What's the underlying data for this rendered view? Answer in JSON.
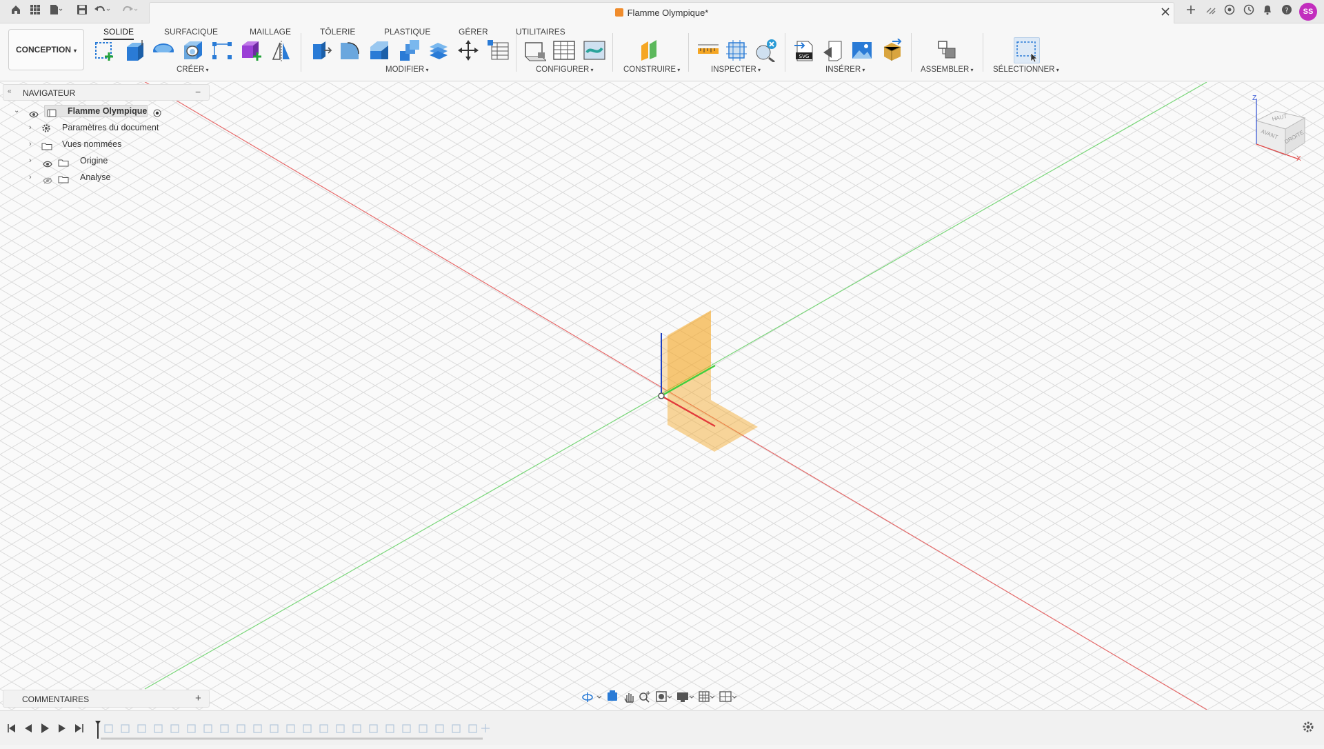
{
  "titlebar": {
    "document_title": "Flamme Olympique*",
    "avatar_initials": "SS",
    "left_icons": [
      "home-icon",
      "grid-icon",
      "file-icon",
      "save-icon",
      "undo-icon",
      "redo-icon"
    ],
    "right_icons": [
      "close-tab-icon",
      "new-tab-icon",
      "sync-icon",
      "extensions-icon",
      "history-icon",
      "notifications-icon",
      "help-icon"
    ]
  },
  "toolbar": {
    "workspace": "CONCEPTION",
    "tabs": [
      {
        "label": "SOLIDE",
        "active": true
      },
      {
        "label": "SURFACIQUE",
        "active": false
      },
      {
        "label": "MAILLAGE",
        "active": false
      },
      {
        "label": "TÔLERIE",
        "active": false
      },
      {
        "label": "PLASTIQUE",
        "active": false
      },
      {
        "label": "GÉRER",
        "active": false
      },
      {
        "label": "UTILITAIRES",
        "active": false
      }
    ],
    "groups": [
      {
        "label": "CRÉER"
      },
      {
        "label": "MODIFIER"
      },
      {
        "label": "CONFIGURER"
      },
      {
        "label": "CONSTRUIRE"
      },
      {
        "label": "INSPECTER"
      },
      {
        "label": "INSÉRER"
      },
      {
        "label": "ASSEMBLER"
      },
      {
        "label": "SÉLECTIONNER"
      }
    ]
  },
  "navigator": {
    "title": "NAVIGATEUR",
    "collapse_symbol": "−",
    "root": "Flamme Olympique",
    "items": [
      {
        "label": "Paramètres du document",
        "icon": "gear-icon"
      },
      {
        "label": "Vues nommées",
        "icon": "folder-icon"
      },
      {
        "label": "Origine",
        "icon": "folder-icon"
      },
      {
        "label": "Analyse",
        "icon": "folder-icon"
      }
    ]
  },
  "comments": {
    "title": "COMMENTAIRES",
    "add_symbol": "+"
  },
  "viewcube": {
    "top": "HAUT",
    "front": "AVANT",
    "right": "DROITE",
    "axis_z": "Z",
    "axis_x": "X"
  },
  "colors": {
    "accent_orange": "#f5a623",
    "axis_red": "#e23b3b",
    "axis_green": "#3fcf3f",
    "axis_blue": "#1e3fbf",
    "avatar": "#c22ebe"
  }
}
